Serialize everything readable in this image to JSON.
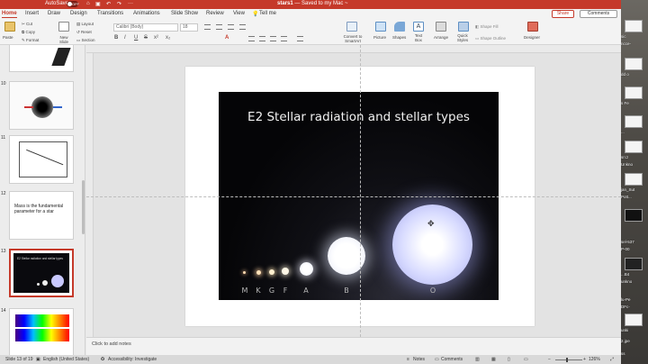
{
  "titlebar": {
    "autosave_label": "AutoSave",
    "autosave_state": "OFF",
    "doc_name": "stars1",
    "doc_status": "— Saved to my Mac ~",
    "accent": "#c5392a"
  },
  "tabs": [
    "Home",
    "Insert",
    "Draw",
    "Design",
    "Transitions",
    "Animations",
    "Slide Show",
    "Review",
    "View",
    "Tell me"
  ],
  "share_label": "Share",
  "comments_label": "Comments",
  "ribbon": {
    "paste": "Paste",
    "cut": "Cut",
    "copy": "Copy",
    "format": "Format",
    "new_slide": "New Slide",
    "layout": "Layout",
    "reset": "Reset",
    "section": "Section",
    "font_value": "Calibri (Body)",
    "size_value": "18",
    "format_buttons": [
      "B",
      "I",
      "U",
      "S",
      "x²",
      "x₂",
      "A"
    ],
    "convert": "Convert to SmartArt",
    "picture": "Picture",
    "shapes": "Shapes",
    "textbox": "Text Box",
    "arrange": "Arrange",
    "quick_styles": "Quick Styles",
    "shape_fill": "Shape Fill",
    "shape_outline": "Shape Outline",
    "designer": "Designer"
  },
  "thumbnails": [
    {
      "num": "",
      "title": ""
    },
    {
      "num": "10",
      "title": ""
    },
    {
      "num": "11",
      "title": ""
    },
    {
      "num": "12",
      "title": "Mass is the fundamental parameter for a star"
    },
    {
      "num": "13",
      "title": "E2 Stellar radiation and stellar types"
    },
    {
      "num": "14",
      "title": ""
    }
  ],
  "slide": {
    "title": "E2 Stellar radiation and stellar types",
    "star_labels": [
      "M",
      "K",
      "G",
      "F",
      "A",
      "B",
      "O"
    ]
  },
  "notes_placeholder": "Click to add notes",
  "status": {
    "slide_counter": "Slide 13 of 19",
    "language": "English (United States)",
    "accessibility": "Accessibility: Investigate",
    "notes": "Notes",
    "comments": "Comments",
    "zoom": "126%"
  },
  "desktop_labels": [
    "sic",
    "ncce-",
    "dd o",
    "s Fe",
    "...",
    "sn:z",
    "Unkno",
    "jan_Sut",
    "Pott...",
    "sel-537",
    "P-00",
    "...B4",
    "unkno",
    "lu-Pe",
    "DFc-",
    "unki",
    "2.jpe",
    "ss"
  ]
}
